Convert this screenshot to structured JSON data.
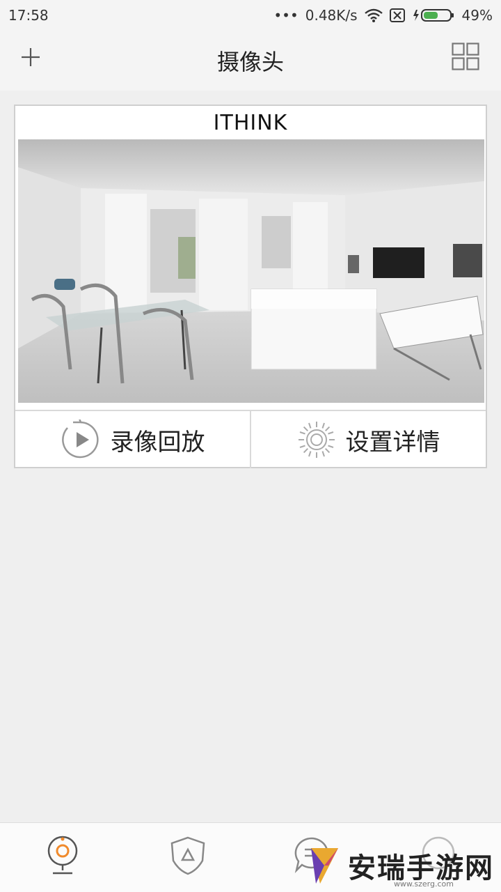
{
  "status_bar": {
    "time": "17:58",
    "net_speed": "0.48K/s",
    "battery": "49%"
  },
  "header": {
    "title": "摄像头"
  },
  "camera": {
    "name": "ITHINK",
    "actions": [
      {
        "label": "录像回放",
        "icon": "playback-icon"
      },
      {
        "label": "设置详情",
        "icon": "gear-icon"
      }
    ]
  },
  "bottom_nav": {
    "items": [
      {
        "icon": "camera-icon",
        "active": true
      },
      {
        "icon": "shield-alert-icon",
        "active": false
      },
      {
        "icon": "message-icon",
        "active": false
      },
      {
        "icon": "profile-icon",
        "active": false
      }
    ],
    "active_color": "#f08a2c"
  },
  "watermark": {
    "text": "安瑞手游网",
    "url": "www.szerg.com"
  }
}
